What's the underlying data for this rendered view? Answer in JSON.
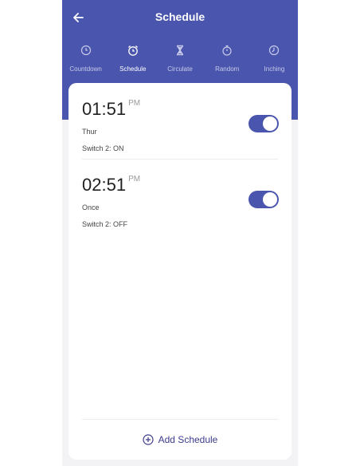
{
  "header": {
    "title": "Schedule",
    "back_icon": "arrow-left-icon",
    "color": "#4a55ad"
  },
  "tabs": [
    {
      "label": "Countdown",
      "icon": "clock-icon",
      "active": false
    },
    {
      "label": "Schedule",
      "icon": "alarm-clock-icon",
      "active": true
    },
    {
      "label": "Circulate",
      "icon": "hourglass-icon",
      "active": false
    },
    {
      "label": "Random",
      "icon": "stopwatch-icon",
      "active": false
    },
    {
      "label": "Inching",
      "icon": "timer-icon",
      "active": false
    }
  ],
  "schedules": [
    {
      "time": "01:51",
      "ampm": "PM",
      "repeat": "Thur",
      "action": "Switch 2: ON",
      "enabled": true
    },
    {
      "time": "02:51",
      "ampm": "PM",
      "repeat": "Once",
      "action": "Switch 2: OFF",
      "enabled": true
    }
  ],
  "add_button": {
    "label": "Add Schedule",
    "icon": "plus-circle-icon"
  }
}
